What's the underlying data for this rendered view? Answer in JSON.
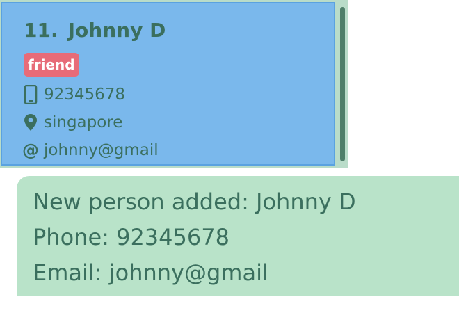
{
  "person": {
    "index": "11.",
    "name": "Johnny D",
    "tag": "friend",
    "phone": "92345678",
    "address": "singapore",
    "email": "johnny@gmail",
    "icons": {
      "phone": "phone-icon",
      "address": "location-pin-icon",
      "email": "at-sign-icon"
    }
  },
  "result": {
    "lines": [
      "New person added: Johnny D",
      "Phone: 92345678",
      "Email: johnny@gmail"
    ]
  },
  "colors": {
    "card_background": "#7ab8ec",
    "tag_background": "#e76b78",
    "result_background": "#b9e3c9",
    "text": "#3b6f5e"
  }
}
